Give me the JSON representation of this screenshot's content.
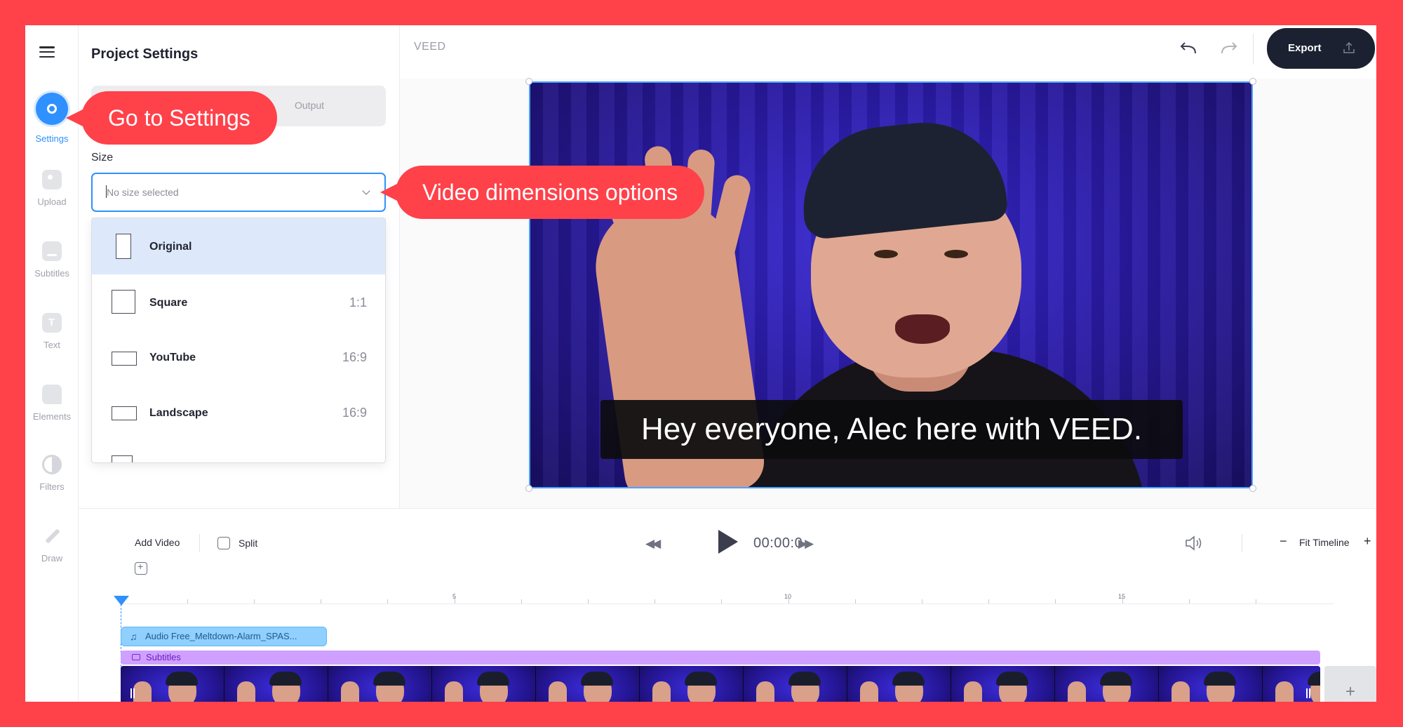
{
  "brand": "VEED",
  "rail": {
    "items": [
      {
        "label": "Settings",
        "icon": "settings-icon"
      },
      {
        "label": "Upload",
        "icon": "upload-icon"
      },
      {
        "label": "Subtitles",
        "icon": "subtitles-icon"
      },
      {
        "label": "Text",
        "icon": "text-icon"
      },
      {
        "label": "Elements",
        "icon": "elements-icon"
      },
      {
        "label": "Filters",
        "icon": "filters-icon"
      },
      {
        "label": "Draw",
        "icon": "draw-icon"
      }
    ]
  },
  "panel": {
    "title": "Project Settings",
    "tabs": {
      "output": "Output"
    },
    "size_label": "Size",
    "size_placeholder": "No size selected",
    "options": [
      {
        "name": "Original",
        "ratio": ""
      },
      {
        "name": "Square",
        "ratio": "1:1"
      },
      {
        "name": "YouTube",
        "ratio": "16:9"
      },
      {
        "name": "Landscape",
        "ratio": "16:9"
      }
    ]
  },
  "topbar": {
    "export_label": "Export"
  },
  "callouts": {
    "settings": "Go to Settings",
    "dimensions": "Video dimensions options"
  },
  "preview": {
    "caption": "Hey everyone, Alec here with VEED."
  },
  "controls": {
    "add_video": "Add Video",
    "split": "Split",
    "time": "00:00:0",
    "fit_timeline": "Fit Timeline"
  },
  "timeline": {
    "ruler_labels": [
      "5",
      "10",
      "15"
    ],
    "audio_track": "Audio Free_Meltdown-Alarm_SPAS...",
    "subtitle_track": "Subtitles",
    "add_clip": "+"
  },
  "colors": {
    "accent": "#2f90ff",
    "callout": "#ff414a",
    "export_button": "#1b2130",
    "audio_track": "#8fd0ff",
    "subtitle_track": "#cfa0ff"
  }
}
